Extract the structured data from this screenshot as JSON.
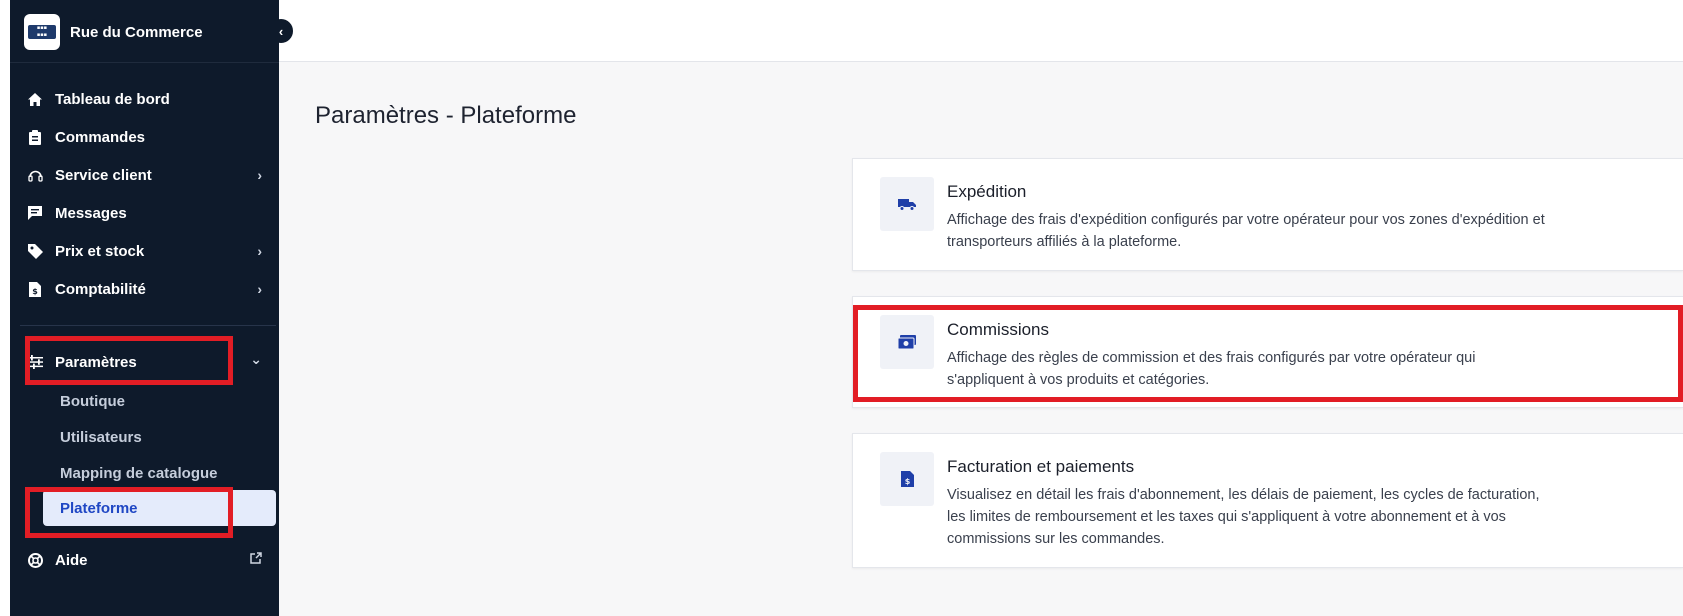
{
  "brand": {
    "name": "Rue du Commerce",
    "logo_text": "RUE DU COMMERCE"
  },
  "sidebar": {
    "items": [
      {
        "label": "Tableau de bord",
        "icon": "home-icon"
      },
      {
        "label": "Commandes",
        "icon": "clipboard-icon"
      },
      {
        "label": "Service client",
        "icon": "headset-icon",
        "chevron": "›"
      },
      {
        "label": "Messages",
        "icon": "message-icon"
      },
      {
        "label": "Prix et stock",
        "icon": "tag-icon",
        "chevron": "›"
      },
      {
        "label": "Comptabilité",
        "icon": "invoice-icon",
        "chevron": "›"
      }
    ],
    "settings": {
      "label": "Paramètres",
      "icon": "sliders-icon",
      "chevron": "⌄"
    },
    "sub_items": [
      {
        "label": "Boutique"
      },
      {
        "label": "Utilisateurs"
      },
      {
        "label": "Mapping de catalogue"
      },
      {
        "label": "Plateforme",
        "active": true
      }
    ],
    "help": {
      "label": "Aide",
      "icon": "lifebuoy-icon"
    }
  },
  "page": {
    "title": "Paramètres - Plateforme"
  },
  "cards": [
    {
      "title": "Expédition",
      "description": "Affichage des frais d'expédition configurés par votre opérateur pour vos zones d'expédition et transporteurs affiliés à la plateforme.",
      "icon": "truck-icon"
    },
    {
      "title": "Commissions",
      "description": "Affichage des règles de commission et des frais configurés par votre opérateur qui s'appliquent à vos produits et catégories.",
      "icon": "money-icon"
    },
    {
      "title": "Facturation et paiements",
      "description": "Visualisez en détail les frais d'abonnement, les délais de paiement, les cycles de facturation, les limites de remboursement et les taxes qui s'appliquent à votre abonnement et à vos commissions sur les commandes.",
      "icon": "invoice-icon"
    }
  ],
  "colors": {
    "sidebar_bg": "#0e1a2b",
    "accent": "#1f47c4",
    "highlight": "#e21d25"
  }
}
